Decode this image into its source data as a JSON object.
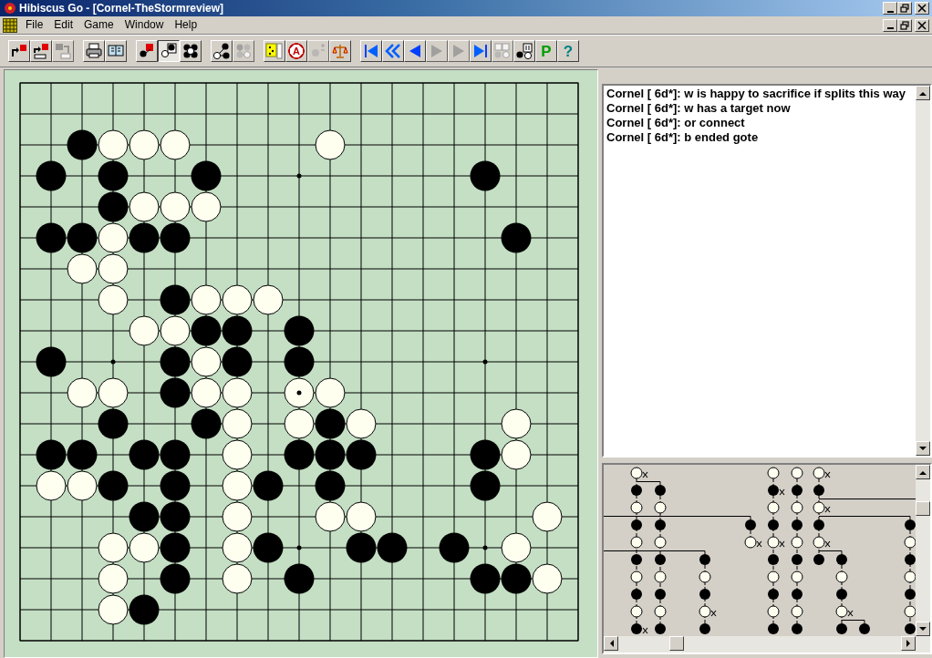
{
  "window": {
    "title": "Hibiscus Go - [Cornel-TheStormreview]"
  },
  "menu": [
    "File",
    "Edit",
    "Game",
    "Window",
    "Help"
  ],
  "toolbar": [
    {
      "disabled": false,
      "pressed": false
    },
    {
      "disabled": false,
      "pressed": false
    },
    {
      "disabled": true,
      "pressed": false
    },
    {
      "disabled": false,
      "pressed": false
    },
    {
      "disabled": false,
      "pressed": false
    },
    {
      "disabled": false,
      "pressed": false
    },
    {
      "disabled": false,
      "pressed": true
    },
    {
      "disabled": false,
      "pressed": false
    },
    {
      "disabled": false,
      "pressed": false
    },
    {
      "disabled": true,
      "pressed": false
    },
    {
      "disabled": false,
      "pressed": false
    },
    {
      "disabled": false,
      "pressed": false,
      "label": "A"
    },
    {
      "disabled": true,
      "pressed": false
    },
    {
      "disabled": false,
      "pressed": false
    },
    {
      "disabled": false,
      "pressed": false
    },
    {
      "disabled": false,
      "pressed": false
    },
    {
      "disabled": false,
      "pressed": false
    },
    {
      "disabled": true,
      "pressed": false
    },
    {
      "disabled": true,
      "pressed": false
    },
    {
      "disabled": false,
      "pressed": false
    },
    {
      "disabled": true,
      "pressed": false
    },
    {
      "disabled": false,
      "pressed": false
    },
    {
      "disabled": false,
      "pressed": false,
      "label": "P"
    },
    {
      "disabled": false,
      "pressed": false,
      "label": "?"
    }
  ],
  "board": {
    "rows": [
      [
        {
          "kind": "empty"
        },
        {
          "kind": "empty"
        },
        {
          "kind": "empty"
        },
        {
          "kind": "empty"
        },
        {
          "kind": "empty"
        },
        {
          "kind": "empty"
        },
        {
          "kind": "empty"
        },
        {
          "kind": "empty"
        },
        {
          "kind": "empty"
        },
        {
          "kind": "empty"
        },
        {
          "kind": "empty"
        },
        {
          "kind": "empty"
        },
        {
          "kind": "empty"
        },
        {
          "kind": "empty"
        },
        {
          "kind": "empty"
        },
        {
          "kind": "empty"
        },
        {
          "kind": "empty"
        },
        {
          "kind": "empty"
        },
        {
          "kind": "empty"
        }
      ],
      [
        {
          "kind": "empty"
        },
        {
          "kind": "empty"
        },
        {
          "kind": "empty"
        },
        {
          "kind": "empty"
        },
        {
          "kind": "empty"
        },
        {
          "kind": "empty"
        },
        {
          "kind": "empty"
        },
        {
          "kind": "empty"
        },
        {
          "kind": "empty"
        },
        {
          "kind": "empty"
        },
        {
          "kind": "empty"
        },
        {
          "kind": "empty"
        },
        {
          "kind": "empty"
        },
        {
          "kind": "empty"
        },
        {
          "kind": "empty"
        },
        {
          "kind": "empty"
        },
        {
          "kind": "empty"
        },
        {
          "kind": "empty"
        },
        {
          "kind": "empty"
        }
      ],
      [
        {
          "kind": "empty"
        },
        {
          "kind": "empty"
        },
        {
          "kind": "black"
        },
        {
          "kind": "white"
        },
        {
          "kind": "white"
        },
        {
          "kind": "white"
        },
        {
          "kind": "empty"
        },
        {
          "kind": "empty"
        },
        {
          "kind": "empty"
        },
        {
          "kind": "empty"
        },
        {
          "kind": "white"
        },
        {
          "kind": "empty"
        },
        {
          "kind": "empty"
        },
        {
          "kind": "empty"
        },
        {
          "kind": "empty"
        },
        {
          "kind": "empty"
        },
        {
          "kind": "empty"
        },
        {
          "kind": "empty"
        },
        {
          "kind": "empty"
        }
      ],
      [
        {
          "kind": "empty"
        },
        {
          "kind": "black"
        },
        {
          "kind": "empty"
        },
        {
          "kind": "black"
        },
        {
          "kind": "empty"
        },
        {
          "kind": "empty"
        },
        {
          "kind": "black"
        },
        {
          "kind": "empty"
        },
        {
          "kind": "empty"
        },
        {
          "kind": "empty"
        },
        {
          "kind": "empty"
        },
        {
          "kind": "empty"
        },
        {
          "kind": "empty"
        },
        {
          "kind": "empty"
        },
        {
          "kind": "empty"
        },
        {
          "kind": "black"
        },
        {
          "kind": "empty"
        },
        {
          "kind": "empty"
        },
        {
          "kind": "empty"
        }
      ],
      [
        {
          "kind": "empty"
        },
        {
          "kind": "empty"
        },
        {
          "kind": "empty"
        },
        {
          "kind": "black"
        },
        {
          "kind": "white"
        },
        {
          "kind": "white"
        },
        {
          "kind": "white"
        },
        {
          "kind": "empty"
        },
        {
          "kind": "empty"
        },
        {
          "kind": "empty"
        },
        {
          "kind": "empty"
        },
        {
          "kind": "empty"
        },
        {
          "kind": "empty"
        },
        {
          "kind": "empty"
        },
        {
          "kind": "empty"
        },
        {
          "kind": "empty"
        },
        {
          "kind": "empty"
        },
        {
          "kind": "empty"
        },
        {
          "kind": "empty"
        }
      ],
      [
        {
          "kind": "empty"
        },
        {
          "kind": "black"
        },
        {
          "kind": "black"
        },
        {
          "kind": "white"
        },
        {
          "kind": "black"
        },
        {
          "kind": "black"
        },
        {
          "kind": "empty"
        },
        {
          "kind": "empty"
        },
        {
          "kind": "empty"
        },
        {
          "kind": "empty"
        },
        {
          "kind": "empty"
        },
        {
          "kind": "empty"
        },
        {
          "kind": "empty"
        },
        {
          "kind": "empty"
        },
        {
          "kind": "empty"
        },
        {
          "kind": "empty"
        },
        {
          "kind": "black"
        },
        {
          "kind": "empty"
        },
        {
          "kind": "empty"
        }
      ],
      [
        {
          "kind": "empty"
        },
        {
          "kind": "empty"
        },
        {
          "kind": "white"
        },
        {
          "kind": "white"
        },
        {
          "kind": "empty"
        },
        {
          "kind": "empty"
        },
        {
          "kind": "empty"
        },
        {
          "kind": "empty"
        },
        {
          "kind": "empty"
        },
        {
          "kind": "empty"
        },
        {
          "kind": "empty"
        },
        {
          "kind": "empty"
        },
        {
          "kind": "empty"
        },
        {
          "kind": "empty"
        },
        {
          "kind": "empty"
        },
        {
          "kind": "empty"
        },
        {
          "kind": "empty"
        },
        {
          "kind": "empty"
        },
        {
          "kind": "empty"
        }
      ],
      [
        {
          "kind": "empty"
        },
        {
          "kind": "empty"
        },
        {
          "kind": "empty"
        },
        {
          "kind": "white"
        },
        {
          "kind": "empty"
        },
        {
          "kind": "black"
        },
        {
          "kind": "white"
        },
        {
          "kind": "white"
        },
        {
          "kind": "white"
        },
        {
          "kind": "empty"
        },
        {
          "kind": "empty"
        },
        {
          "kind": "empty"
        },
        {
          "kind": "empty"
        },
        {
          "kind": "empty"
        },
        {
          "kind": "empty"
        },
        {
          "kind": "empty"
        },
        {
          "kind": "empty"
        },
        {
          "kind": "empty"
        },
        {
          "kind": "empty"
        }
      ],
      [
        {
          "kind": "empty"
        },
        {
          "kind": "empty"
        },
        {
          "kind": "empty"
        },
        {
          "kind": "empty"
        },
        {
          "kind": "white"
        },
        {
          "kind": "white"
        },
        {
          "kind": "black"
        },
        {
          "kind": "black"
        },
        {
          "kind": "empty"
        },
        {
          "kind": "black"
        },
        {
          "kind": "empty"
        },
        {
          "kind": "empty"
        },
        {
          "kind": "empty"
        },
        {
          "kind": "empty"
        },
        {
          "kind": "empty"
        },
        {
          "kind": "empty"
        },
        {
          "kind": "empty"
        },
        {
          "kind": "empty"
        },
        {
          "kind": "empty"
        }
      ],
      [
        {
          "kind": "empty"
        },
        {
          "kind": "black"
        },
        {
          "kind": "empty"
        },
        {
          "kind": "empty"
        },
        {
          "kind": "empty"
        },
        {
          "kind": "black"
        },
        {
          "kind": "white"
        },
        {
          "kind": "black"
        },
        {
          "kind": "empty"
        },
        {
          "kind": "black"
        },
        {
          "kind": "empty"
        },
        {
          "kind": "empty"
        },
        {
          "kind": "empty"
        },
        {
          "kind": "empty"
        },
        {
          "kind": "empty"
        },
        {
          "kind": "empty"
        },
        {
          "kind": "empty"
        },
        {
          "kind": "empty"
        },
        {
          "kind": "empty"
        }
      ],
      [
        {
          "kind": "empty"
        },
        {
          "kind": "empty"
        },
        {
          "kind": "white"
        },
        {
          "kind": "white"
        },
        {
          "kind": "empty"
        },
        {
          "kind": "black"
        },
        {
          "kind": "white"
        },
        {
          "kind": "white"
        },
        {
          "kind": "empty"
        },
        {
          "kind": "lastmove"
        },
        {
          "kind": "white"
        },
        {
          "kind": "empty"
        },
        {
          "kind": "empty"
        },
        {
          "kind": "empty"
        },
        {
          "kind": "empty"
        },
        {
          "kind": "empty"
        },
        {
          "kind": "empty"
        },
        {
          "kind": "empty"
        },
        {
          "kind": "empty"
        }
      ],
      [
        {
          "kind": "empty"
        },
        {
          "kind": "empty"
        },
        {
          "kind": "empty"
        },
        {
          "kind": "black"
        },
        {
          "kind": "empty"
        },
        {
          "kind": "empty"
        },
        {
          "kind": "black"
        },
        {
          "kind": "white"
        },
        {
          "kind": "empty"
        },
        {
          "kind": "white"
        },
        {
          "kind": "black"
        },
        {
          "kind": "white"
        },
        {
          "kind": "empty"
        },
        {
          "kind": "empty"
        },
        {
          "kind": "empty"
        },
        {
          "kind": "empty"
        },
        {
          "kind": "white"
        },
        {
          "kind": "empty"
        },
        {
          "kind": "empty"
        }
      ],
      [
        {
          "kind": "empty"
        },
        {
          "kind": "black"
        },
        {
          "kind": "black"
        },
        {
          "kind": "empty"
        },
        {
          "kind": "black"
        },
        {
          "kind": "black"
        },
        {
          "kind": "empty"
        },
        {
          "kind": "white"
        },
        {
          "kind": "empty"
        },
        {
          "kind": "black"
        },
        {
          "kind": "black"
        },
        {
          "kind": "black"
        },
        {
          "kind": "empty"
        },
        {
          "kind": "empty"
        },
        {
          "kind": "empty"
        },
        {
          "kind": "black"
        },
        {
          "kind": "white"
        },
        {
          "kind": "empty"
        },
        {
          "kind": "empty"
        }
      ],
      [
        {
          "kind": "empty"
        },
        {
          "kind": "white"
        },
        {
          "kind": "white"
        },
        {
          "kind": "black"
        },
        {
          "kind": "empty"
        },
        {
          "kind": "black"
        },
        {
          "kind": "empty"
        },
        {
          "kind": "white"
        },
        {
          "kind": "black"
        },
        {
          "kind": "empty"
        },
        {
          "kind": "black"
        },
        {
          "kind": "empty"
        },
        {
          "kind": "empty"
        },
        {
          "kind": "empty"
        },
        {
          "kind": "empty"
        },
        {
          "kind": "black"
        },
        {
          "kind": "empty"
        },
        {
          "kind": "empty"
        },
        {
          "kind": "empty"
        }
      ],
      [
        {
          "kind": "empty"
        },
        {
          "kind": "empty"
        },
        {
          "kind": "empty"
        },
        {
          "kind": "empty"
        },
        {
          "kind": "black"
        },
        {
          "kind": "black"
        },
        {
          "kind": "empty"
        },
        {
          "kind": "white"
        },
        {
          "kind": "empty"
        },
        {
          "kind": "empty"
        },
        {
          "kind": "white"
        },
        {
          "kind": "white"
        },
        {
          "kind": "empty"
        },
        {
          "kind": "empty"
        },
        {
          "kind": "empty"
        },
        {
          "kind": "empty"
        },
        {
          "kind": "empty"
        },
        {
          "kind": "white"
        },
        {
          "kind": "empty"
        }
      ],
      [
        {
          "kind": "empty"
        },
        {
          "kind": "empty"
        },
        {
          "kind": "empty"
        },
        {
          "kind": "white"
        },
        {
          "kind": "white"
        },
        {
          "kind": "black"
        },
        {
          "kind": "empty"
        },
        {
          "kind": "white"
        },
        {
          "kind": "black"
        },
        {
          "kind": "empty"
        },
        {
          "kind": "empty"
        },
        {
          "kind": "black"
        },
        {
          "kind": "black"
        },
        {
          "kind": "empty"
        },
        {
          "kind": "black"
        },
        {
          "kind": "empty"
        },
        {
          "kind": "white"
        },
        {
          "kind": "empty"
        },
        {
          "kind": "empty"
        }
      ],
      [
        {
          "kind": "empty"
        },
        {
          "kind": "empty"
        },
        {
          "kind": "empty"
        },
        {
          "kind": "white"
        },
        {
          "kind": "empty"
        },
        {
          "kind": "black"
        },
        {
          "kind": "empty"
        },
        {
          "kind": "white"
        },
        {
          "kind": "empty"
        },
        {
          "kind": "black"
        },
        {
          "kind": "empty"
        },
        {
          "kind": "empty"
        },
        {
          "kind": "empty"
        },
        {
          "kind": "empty"
        },
        {
          "kind": "empty"
        },
        {
          "kind": "black"
        },
        {
          "kind": "black"
        },
        {
          "kind": "white"
        },
        {
          "kind": "empty"
        }
      ],
      [
        {
          "kind": "empty"
        },
        {
          "kind": "empty"
        },
        {
          "kind": "empty"
        },
        {
          "kind": "white"
        },
        {
          "kind": "black"
        },
        {
          "kind": "empty"
        },
        {
          "kind": "empty"
        },
        {
          "kind": "empty"
        },
        {
          "kind": "empty"
        },
        {
          "kind": "empty"
        },
        {
          "kind": "empty"
        },
        {
          "kind": "empty"
        },
        {
          "kind": "empty"
        },
        {
          "kind": "empty"
        },
        {
          "kind": "empty"
        },
        {
          "kind": "empty"
        },
        {
          "kind": "empty"
        },
        {
          "kind": "empty"
        },
        {
          "kind": "empty"
        }
      ],
      [
        {
          "kind": "empty"
        },
        {
          "kind": "empty"
        },
        {
          "kind": "empty"
        },
        {
          "kind": "empty"
        },
        {
          "kind": "empty"
        },
        {
          "kind": "empty"
        },
        {
          "kind": "empty"
        },
        {
          "kind": "empty"
        },
        {
          "kind": "empty"
        },
        {
          "kind": "empty"
        },
        {
          "kind": "empty"
        },
        {
          "kind": "empty"
        },
        {
          "kind": "empty"
        },
        {
          "kind": "empty"
        },
        {
          "kind": "empty"
        },
        {
          "kind": "empty"
        },
        {
          "kind": "empty"
        },
        {
          "kind": "empty"
        },
        {
          "kind": "empty"
        }
      ]
    ]
  },
  "chat": {
    "lines": [
      "Cornel [ 6d*]: w is happy to sacrifice if splits this way",
      "Cornel [ 6d*]: w has a target now",
      "Cornel [ 6d*]: or connect",
      "Cornel [ 6d*]: b ended gote"
    ]
  }
}
